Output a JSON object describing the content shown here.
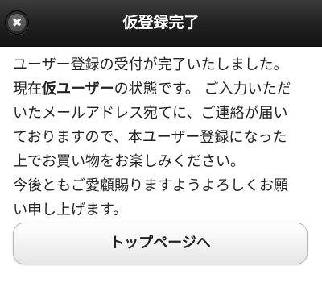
{
  "header": {
    "title": "仮登録完了",
    "close_icon": "✖"
  },
  "message": {
    "line1": "ユーザー登録の受付が完了いたしました。",
    "line2_prefix": "現在",
    "line2_bold": "仮ユーザー",
    "line2_suffix": "の状態です。 ご入力いただ",
    "line3": "いたメールアドレス宛てに、ご連絡が届い",
    "line4": "ておりますので、本ユーザー登録になった",
    "line5": "上でお買い物をお楽しみください。",
    "line6": "今後ともご愛顧賜りますようよろしくお願",
    "line7": "い申し上げます。"
  },
  "buttons": {
    "top_page_label": "トップページへ"
  }
}
